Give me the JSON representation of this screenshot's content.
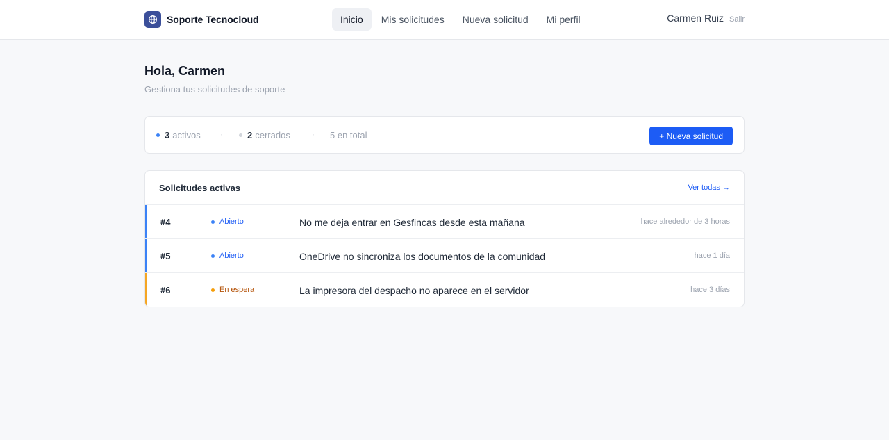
{
  "brand": {
    "name": "Soporte Tecnocloud",
    "logo_icon": "globe-icon",
    "logo_color": "#3b4f9a"
  },
  "nav": {
    "items": [
      {
        "label": "Inicio",
        "active": true
      },
      {
        "label": "Mis solicitudes",
        "active": false
      },
      {
        "label": "Nueva solicitud",
        "active": false
      },
      {
        "label": "Mi perfil",
        "active": false
      }
    ]
  },
  "user": {
    "name": "Carmen Ruiz",
    "logout_label": "Salir"
  },
  "greeting": {
    "title": "Hola, Carmen",
    "subtitle": "Gestiona tus solicitudes de soporte"
  },
  "stats": {
    "active": {
      "count": "3",
      "label": "activos",
      "color": "#3b82f6"
    },
    "closed": {
      "count": "2",
      "label": "cerrados",
      "color": "#d1d5db"
    },
    "total_label": "5 en total",
    "separator": "·",
    "new_button_label": "+ Nueva solicitud"
  },
  "active_tickets": {
    "title": "Solicitudes activas",
    "view_all_label": "Ver todas →",
    "rows": [
      {
        "id": "#4",
        "status": "Abierto",
        "status_color": "#1d5cf5",
        "dot_color": "#3b82f6",
        "accent_color": "#3b82f6",
        "subject": "No me deja entrar en Gesfincas desde esta mañana",
        "time": "hace alrededor de 3 horas"
      },
      {
        "id": "#5",
        "status": "Abierto",
        "status_color": "#1d5cf5",
        "dot_color": "#3b82f6",
        "accent_color": "#3b82f6",
        "subject": "OneDrive no sincroniza los documentos de la comunidad",
        "time": "hace 1 día"
      },
      {
        "id": "#6",
        "status": "En espera",
        "status_color": "#b45309",
        "dot_color": "#f59e0b",
        "accent_color": "#f5a623",
        "subject": "La impresora del despacho no aparece en el servidor",
        "time": "hace 3 días"
      }
    ]
  }
}
